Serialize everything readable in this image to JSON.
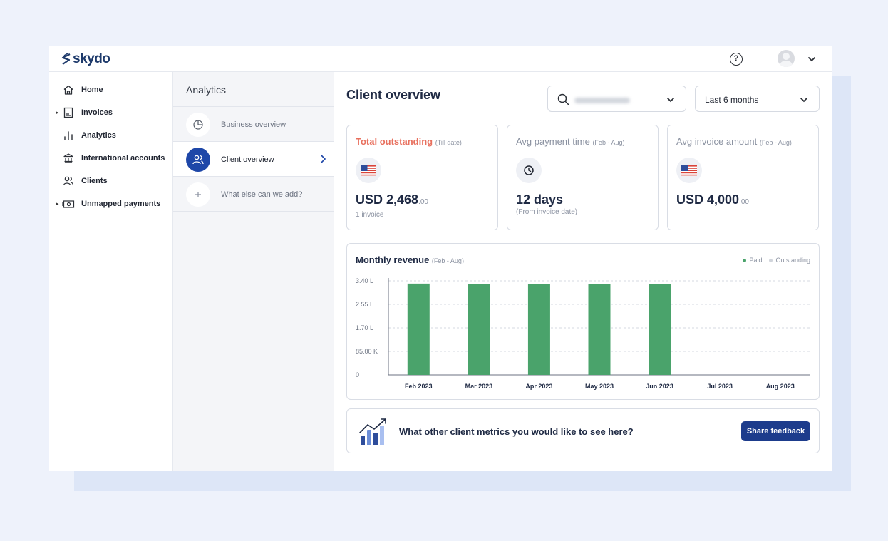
{
  "brand": {
    "name": "skydo"
  },
  "sidebar": {
    "items": [
      {
        "label": "Home",
        "icon": "home-icon",
        "has_caret": false
      },
      {
        "label": "Invoices",
        "icon": "invoice-icon",
        "has_caret": true
      },
      {
        "label": "Analytics",
        "icon": "analytics-icon",
        "has_caret": false
      },
      {
        "label": "International accounts",
        "icon": "bank-icon",
        "has_caret": false
      },
      {
        "label": "Clients",
        "icon": "clients-icon",
        "has_caret": false
      },
      {
        "label": "Unmapped payments",
        "icon": "money-icon",
        "has_caret": true
      }
    ]
  },
  "analytics_panel": {
    "title": "Analytics",
    "items": [
      {
        "label": "Business overview",
        "icon": "pie-chart-icon",
        "active": false
      },
      {
        "label": "Client overview",
        "icon": "users-icon",
        "active": true
      },
      {
        "label": "What else can we add?",
        "icon": "plus-icon",
        "active": false
      }
    ]
  },
  "main": {
    "title": "Client overview",
    "period_select": {
      "value": "Last 6 months"
    },
    "stats": [
      {
        "title": "Total outstanding",
        "subtitle": "(Till date)",
        "icon": "us-flag-icon",
        "value": "USD 2,468",
        "cents": ".00",
        "note": "1 invoice"
      },
      {
        "title": "Avg payment time",
        "subtitle": "(Feb - Aug)",
        "icon": "clock-icon",
        "value": "12 days",
        "cents": "",
        "note": "(From invoice date)"
      },
      {
        "title": "Avg invoice amount",
        "subtitle": "(Feb - Aug)",
        "icon": "us-flag-icon",
        "value": "USD 4,000",
        "cents": ".00",
        "note": ""
      }
    ],
    "feedback": {
      "text": "What other client metrics you would like to see here?",
      "button": "Share feedback"
    }
  },
  "colors": {
    "accent": "#1e47a8",
    "paid": "#4aa36b",
    "outstanding": "#d0d4db",
    "danger": "#e8705e",
    "button": "#1d3c8c"
  },
  "chart_data": {
    "type": "bar",
    "title": "Monthly revenue",
    "subtitle": "(Feb - Aug)",
    "categories": [
      "Feb 2023",
      "Mar 2023",
      "Apr 2023",
      "May 2023",
      "Jun 2023",
      "Jul 2023",
      "Aug 2023"
    ],
    "series": [
      {
        "name": "Paid",
        "values": [
          330000,
          328000,
          328000,
          329000,
          328000,
          0,
          0
        ]
      },
      {
        "name": "Outstanding",
        "values": [
          0,
          0,
          0,
          0,
          0,
          0,
          0
        ]
      }
    ],
    "y_ticks": [
      0,
      85000,
      170000,
      255000,
      340000
    ],
    "y_tick_labels": [
      "0",
      "85.00 K",
      "1.70 L",
      "2.55 L",
      "3.40 L"
    ],
    "ylim": [
      0,
      340000
    ],
    "grid": true,
    "legend": "top-right"
  }
}
